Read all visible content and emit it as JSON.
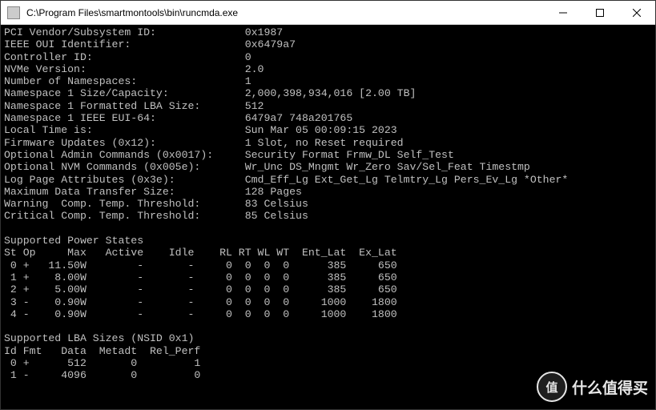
{
  "window": {
    "title": "C:\\Program Files\\smartmontools\\bin\\runcmda.exe"
  },
  "info": [
    {
      "k": "PCI Vendor/Subsystem ID:",
      "v": "0x1987"
    },
    {
      "k": "IEEE OUI Identifier:",
      "v": "0x6479a7"
    },
    {
      "k": "Controller ID:",
      "v": "0"
    },
    {
      "k": "NVMe Version:",
      "v": "2.0"
    },
    {
      "k": "Number of Namespaces:",
      "v": "1"
    },
    {
      "k": "Namespace 1 Size/Capacity:",
      "v": "2,000,398,934,016 [2.00 TB]"
    },
    {
      "k": "Namespace 1 Formatted LBA Size:",
      "v": "512"
    },
    {
      "k": "Namespace 1 IEEE EUI-64:",
      "v": "6479a7 748a201765"
    },
    {
      "k": "Local Time is:",
      "v": "Sun Mar 05 00:09:15 2023"
    },
    {
      "k": "Firmware Updates (0x12):",
      "v": "1 Slot, no Reset required"
    },
    {
      "k": "Optional Admin Commands (0x0017):",
      "v": "Security Format Frmw_DL Self_Test"
    },
    {
      "k": "Optional NVM Commands (0x005e):",
      "v": "Wr_Unc DS_Mngmt Wr_Zero Sav/Sel_Feat Timestmp"
    },
    {
      "k": "Log Page Attributes (0x3e):",
      "v": "Cmd_Eff_Lg Ext_Get_Lg Telmtry_Lg Pers_Ev_Lg *Other*"
    },
    {
      "k": "Maximum Data Transfer Size:",
      "v": "128 Pages"
    },
    {
      "k": "Warning  Comp. Temp. Threshold:",
      "v": "83 Celsius"
    },
    {
      "k": "Critical Comp. Temp. Threshold:",
      "v": "85 Celsius"
    }
  ],
  "power_states": {
    "title": "Supported Power States",
    "header": {
      "st": "St",
      "op": "Op",
      "max": "Max",
      "active": "Active",
      "idle": "Idle",
      "rl": "RL",
      "rt": "RT",
      "wl": "WL",
      "wt": "WT",
      "ent": "Ent_Lat",
      "ex": "Ex_Lat"
    },
    "rows": [
      {
        "st": "0",
        "op": "+",
        "max": "11.50W",
        "active": "-",
        "idle": "-",
        "rl": "0",
        "rt": "0",
        "wl": "0",
        "wt": "0",
        "ent": "385",
        "ex": "650"
      },
      {
        "st": "1",
        "op": "+",
        "max": "8.00W",
        "active": "-",
        "idle": "-",
        "rl": "0",
        "rt": "0",
        "wl": "0",
        "wt": "0",
        "ent": "385",
        "ex": "650"
      },
      {
        "st": "2",
        "op": "+",
        "max": "5.00W",
        "active": "-",
        "idle": "-",
        "rl": "0",
        "rt": "0",
        "wl": "0",
        "wt": "0",
        "ent": "385",
        "ex": "650"
      },
      {
        "st": "3",
        "op": "-",
        "max": "0.90W",
        "active": "-",
        "idle": "-",
        "rl": "0",
        "rt": "0",
        "wl": "0",
        "wt": "0",
        "ent": "1000",
        "ex": "1800"
      },
      {
        "st": "4",
        "op": "-",
        "max": "0.90W",
        "active": "-",
        "idle": "-",
        "rl": "0",
        "rt": "0",
        "wl": "0",
        "wt": "0",
        "ent": "1000",
        "ex": "1800"
      }
    ]
  },
  "lba_sizes": {
    "title": "Supported LBA Sizes (NSID 0x1)",
    "header": {
      "id": "Id",
      "fmt": "Fmt",
      "data": "Data",
      "metadt": "Metadt",
      "rel_perf": "Rel_Perf"
    },
    "rows": [
      {
        "id": "0",
        "fmt": "+",
        "data": "512",
        "metadt": "0",
        "rel_perf": "1"
      },
      {
        "id": "1",
        "fmt": "-",
        "data": "4096",
        "metadt": "0",
        "rel_perf": "0"
      }
    ]
  },
  "watermark": {
    "badge": "值",
    "text": "什么值得买"
  }
}
